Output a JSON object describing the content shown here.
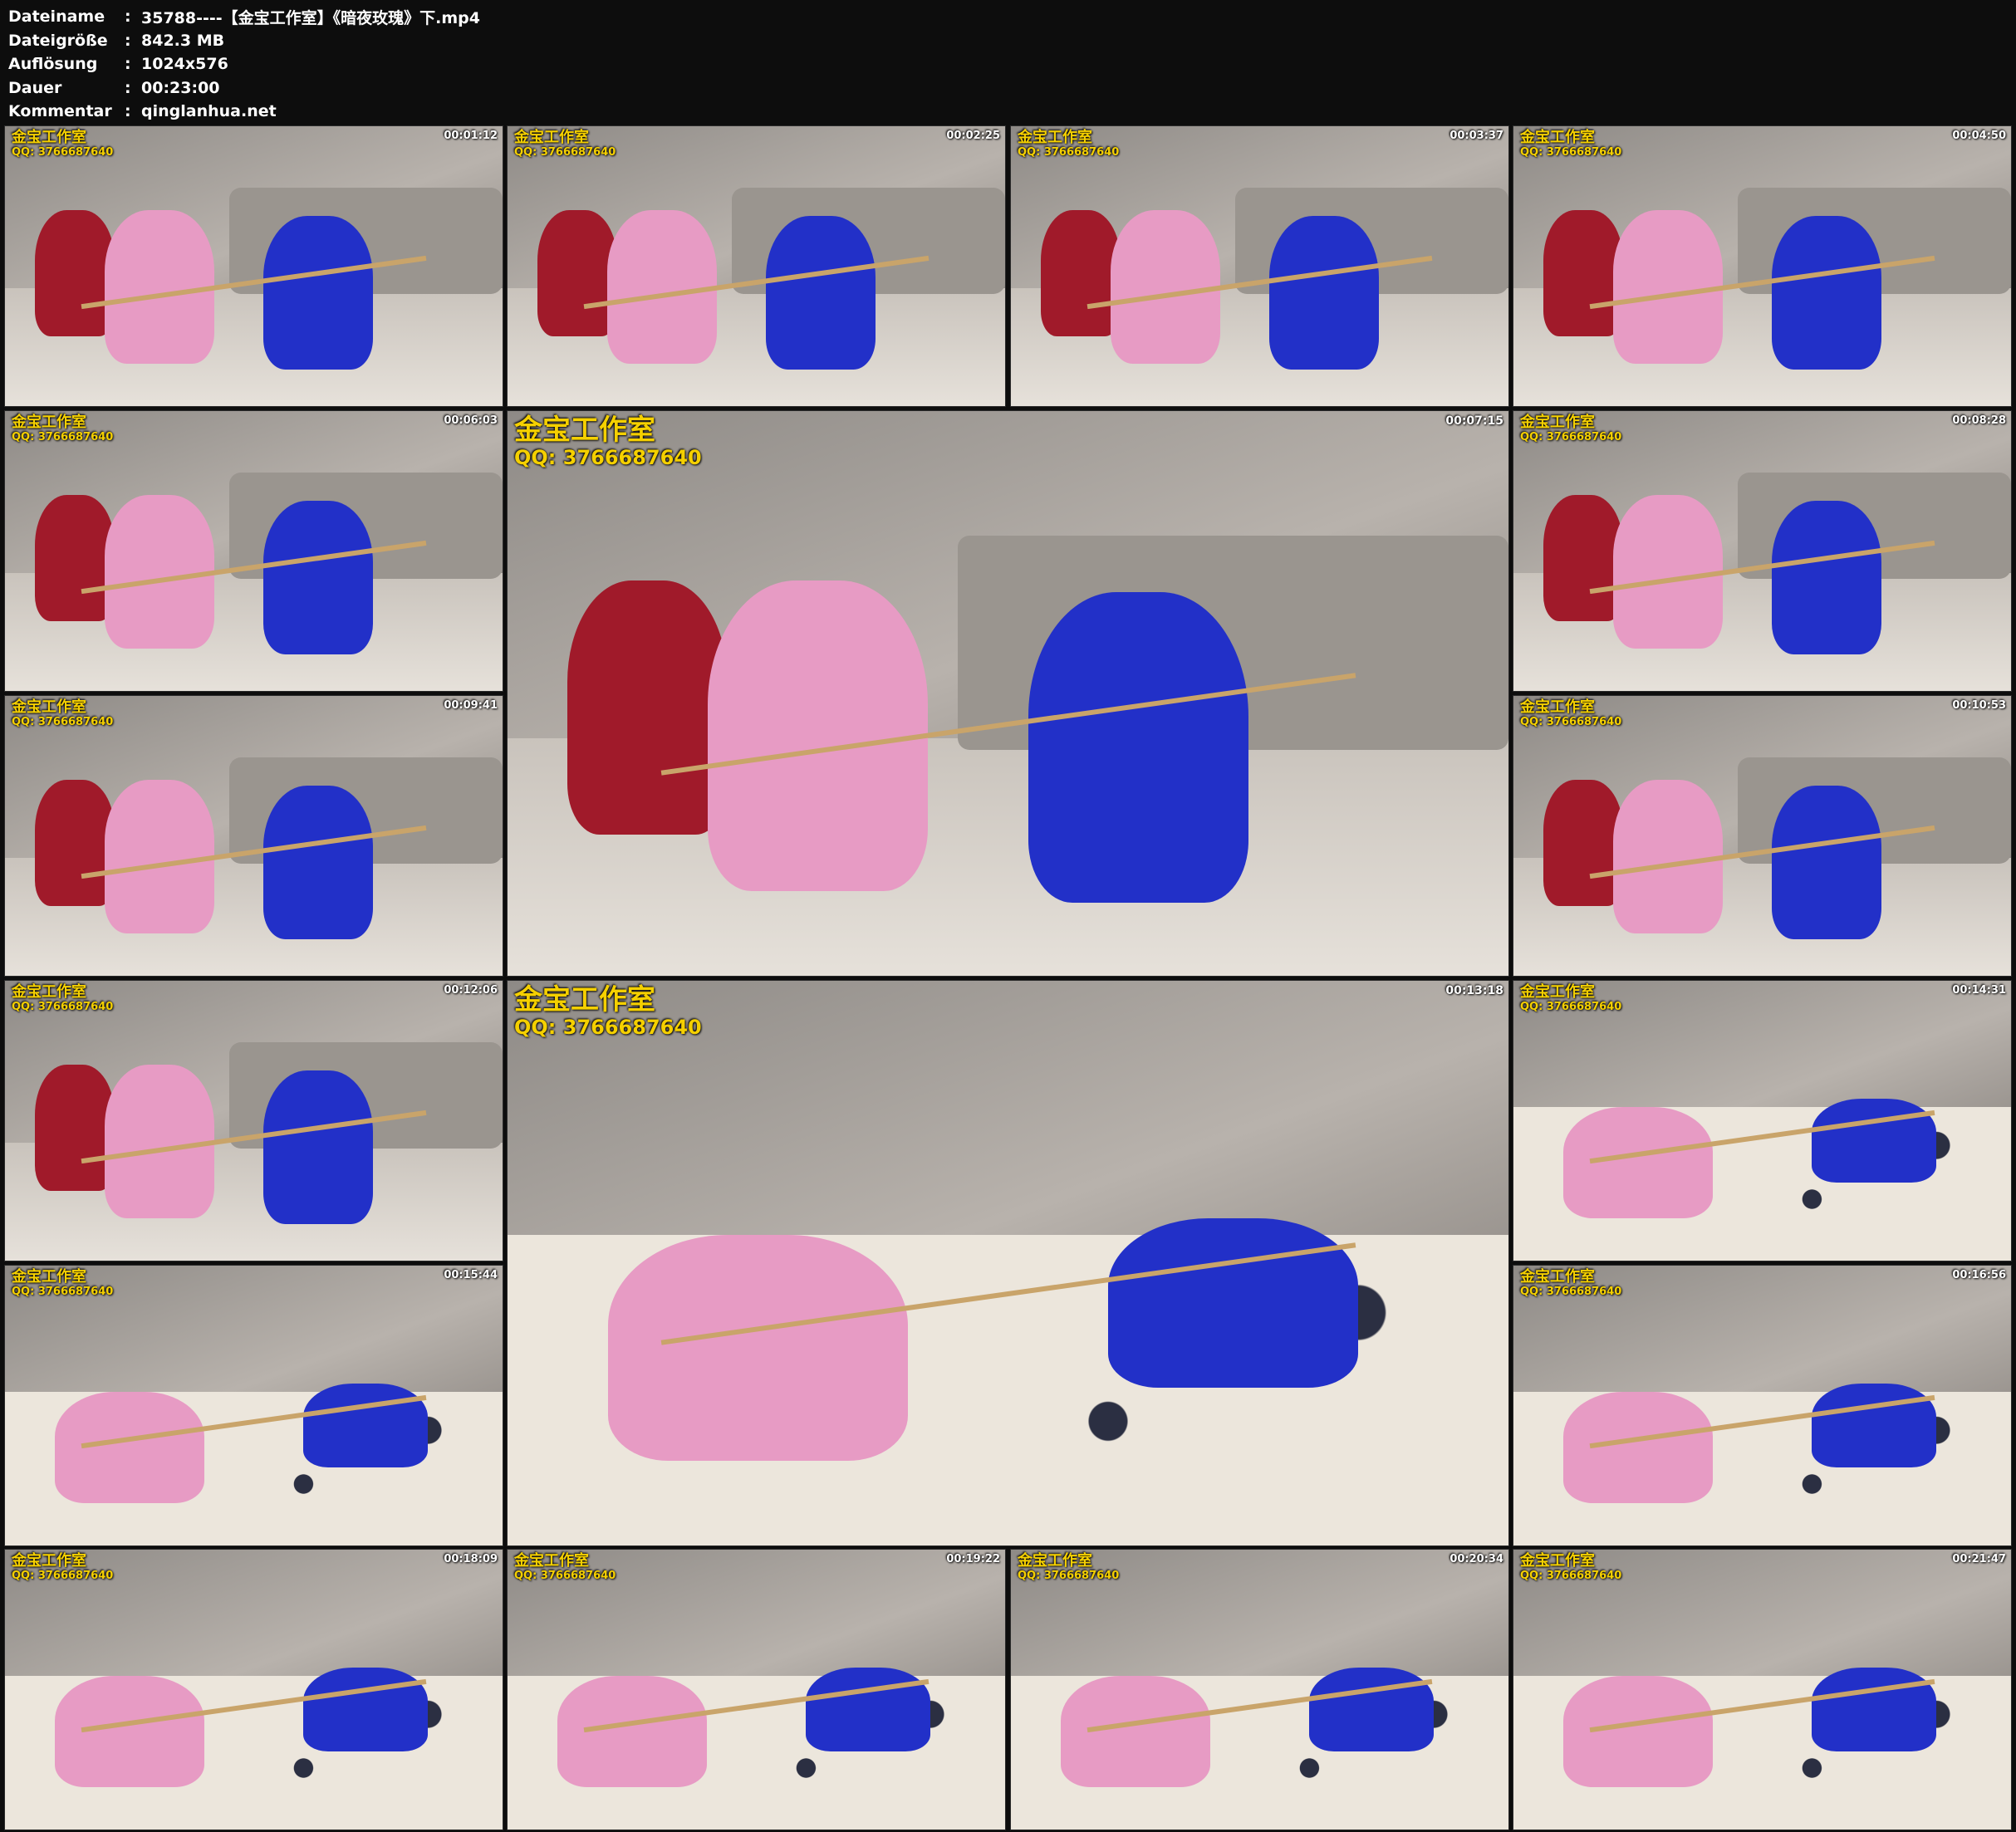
{
  "file_info": [
    {
      "key": "Dateiname",
      "value": "35788----【金宝工作室】《暗夜玫瑰》下.mp4"
    },
    {
      "key": "Dateigröße",
      "value": "842.3 MB"
    },
    {
      "key": "Auflösung",
      "value": "1024x576"
    },
    {
      "key": "Dauer",
      "value": "00:23:00"
    },
    {
      "key": "Kommentar",
      "value": "qinglanhua.net"
    }
  ],
  "separator": ":",
  "watermark": {
    "title": "金宝工作室",
    "qq": "QQ: 3766687640"
  },
  "thumbnails": [
    {
      "time": "00:01:12",
      "scene": "room"
    },
    {
      "time": "00:02:25",
      "scene": "room"
    },
    {
      "time": "00:03:37",
      "scene": "room"
    },
    {
      "time": "00:04:50",
      "scene": "room"
    },
    {
      "time": "00:06:03",
      "scene": "room"
    },
    {
      "time": "00:07:15",
      "scene": "room"
    },
    {
      "time": "00:08:28",
      "scene": "room"
    },
    {
      "time": "00:09:41",
      "scene": "room"
    },
    {
      "time": "00:10:53",
      "scene": "room"
    },
    {
      "time": "00:12:06",
      "scene": "room"
    },
    {
      "time": "00:13:18",
      "scene": "bed"
    },
    {
      "time": "00:14:31",
      "scene": "bed"
    },
    {
      "time": "00:15:44",
      "scene": "bed"
    },
    {
      "time": "00:16:56",
      "scene": "bed"
    },
    {
      "time": "00:18:09",
      "scene": "bed"
    },
    {
      "time": "00:19:22",
      "scene": "bed"
    },
    {
      "time": "00:20:34",
      "scene": "bed"
    },
    {
      "time": "00:21:47",
      "scene": "bed"
    }
  ]
}
